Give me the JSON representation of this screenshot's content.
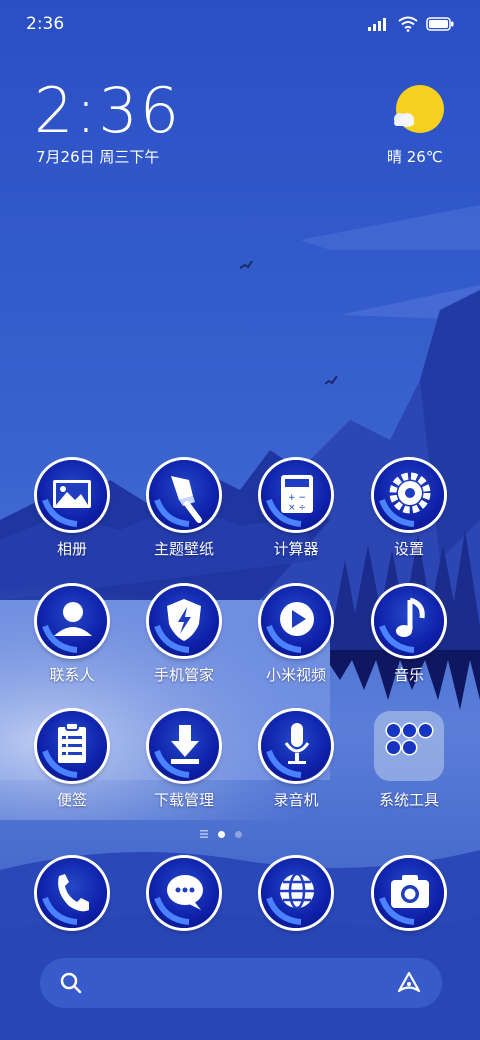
{
  "status_bar": {
    "time": "2:36"
  },
  "clock": {
    "time": "2:36",
    "date": "7月26日 周三下午"
  },
  "weather": {
    "text": "晴 26℃"
  },
  "apps": [
    {
      "label": "相册",
      "icon": "gallery-icon"
    },
    {
      "label": "主题壁纸",
      "icon": "paintbrush-icon"
    },
    {
      "label": "计算器",
      "icon": "calculator-icon"
    },
    {
      "label": "设置",
      "icon": "gear-icon"
    },
    {
      "label": "联系人",
      "icon": "contact-icon"
    },
    {
      "label": "手机管家",
      "icon": "shield-icon"
    },
    {
      "label": "小米视频",
      "icon": "play-icon"
    },
    {
      "label": "音乐",
      "icon": "music-note-icon"
    },
    {
      "label": "便签",
      "icon": "notepad-icon"
    },
    {
      "label": "下载管理",
      "icon": "download-icon"
    },
    {
      "label": "录音机",
      "icon": "microphone-icon"
    }
  ],
  "folder": {
    "label": "系统工具"
  },
  "dock": [
    {
      "icon": "phone-icon"
    },
    {
      "icon": "message-icon"
    },
    {
      "icon": "browser-globe-icon"
    },
    {
      "icon": "camera-icon"
    }
  ],
  "colors": {
    "sky_top": "#2a4fc4",
    "icon_blue": "#0e20a8",
    "mountain_dark": "#1a2a8a"
  }
}
